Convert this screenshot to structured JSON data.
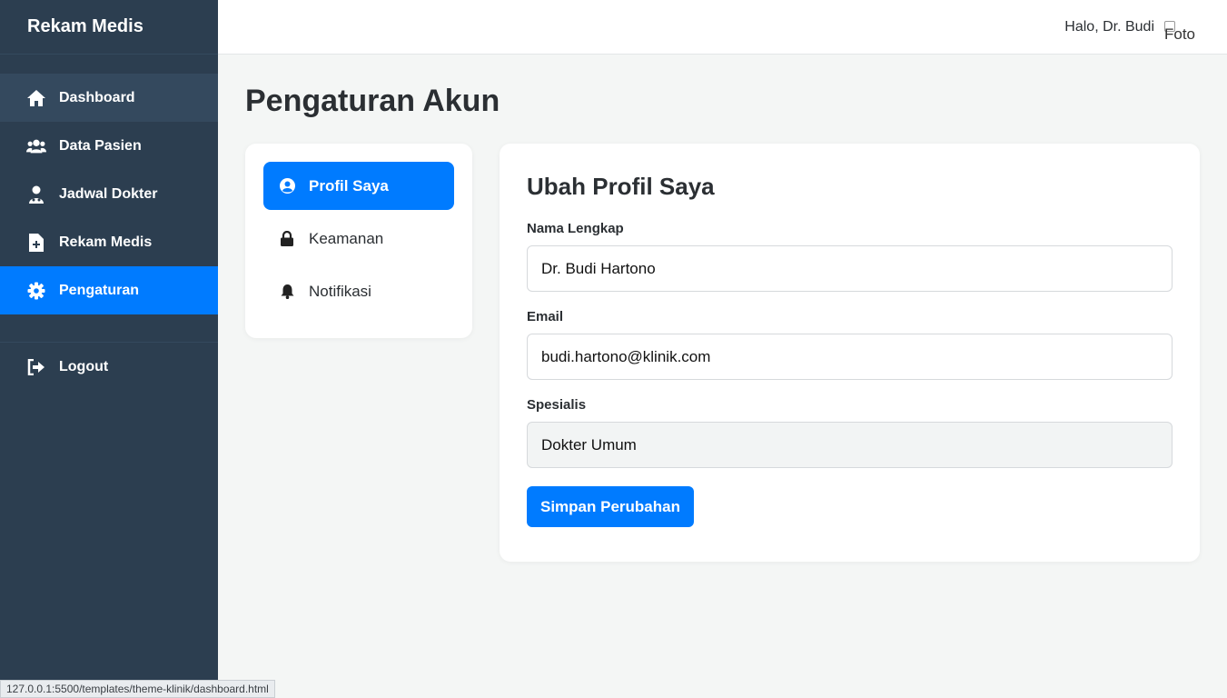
{
  "app": {
    "brand": "Rekam Medis"
  },
  "sidebar": {
    "items": [
      {
        "label": "Dashboard",
        "icon": "home-icon"
      },
      {
        "label": "Data Pasien",
        "icon": "users-icon"
      },
      {
        "label": "Jadwal Dokter",
        "icon": "doctor-icon"
      },
      {
        "label": "Rekam Medis",
        "icon": "file-medical-icon"
      },
      {
        "label": "Pengaturan",
        "icon": "gear-icon"
      }
    ],
    "logout_label": "Logout"
  },
  "header": {
    "greeting": "Halo, Dr. Budi",
    "avatar_alt": "Foto"
  },
  "page": {
    "title": "Pengaturan Akun"
  },
  "settings_menu": {
    "items": [
      {
        "label": "Profil Saya",
        "icon": "user-circle-icon",
        "active": true
      },
      {
        "label": "Keamanan",
        "icon": "lock-icon",
        "active": false
      },
      {
        "label": "Notifikasi",
        "icon": "bell-icon",
        "active": false
      }
    ]
  },
  "profile_form": {
    "title": "Ubah Profil Saya",
    "name_label": "Nama Lengkap",
    "name_value": "Dr. Budi Hartono",
    "email_label": "Email",
    "email_value": "budi.hartono@klinik.com",
    "specialty_label": "Spesialis",
    "specialty_value": "Dokter Umum",
    "save_label": "Simpan Perubahan"
  },
  "status_bar": {
    "url": "127.0.0.1:5500/templates/theme-klinik/dashboard.html"
  },
  "colors": {
    "sidebar_bg": "#2c3e50",
    "accent": "#007bff",
    "page_bg": "#f4f6f5"
  }
}
